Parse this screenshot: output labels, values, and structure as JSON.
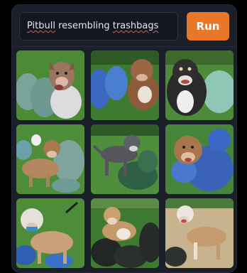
{
  "prompt": {
    "word1": "Pitbull",
    "word2": " resembling ",
    "word3": "trashbags"
  },
  "run_button": {
    "label": "Run"
  },
  "images": [
    {
      "alt": "Generated image 1"
    },
    {
      "alt": "Generated image 2"
    },
    {
      "alt": "Generated image 3"
    },
    {
      "alt": "Generated image 4"
    },
    {
      "alt": "Generated image 5"
    },
    {
      "alt": "Generated image 6"
    },
    {
      "alt": "Generated image 7"
    },
    {
      "alt": "Generated image 8"
    },
    {
      "alt": "Generated image 9"
    }
  ],
  "colors": {
    "accent": "#e8772c",
    "panel": "#1b1f2a",
    "grass": "#4f8a38",
    "bag_green": "#5a8a7a",
    "bag_blue": "#3a6fc4",
    "bag_black": "#2a2f2e"
  }
}
